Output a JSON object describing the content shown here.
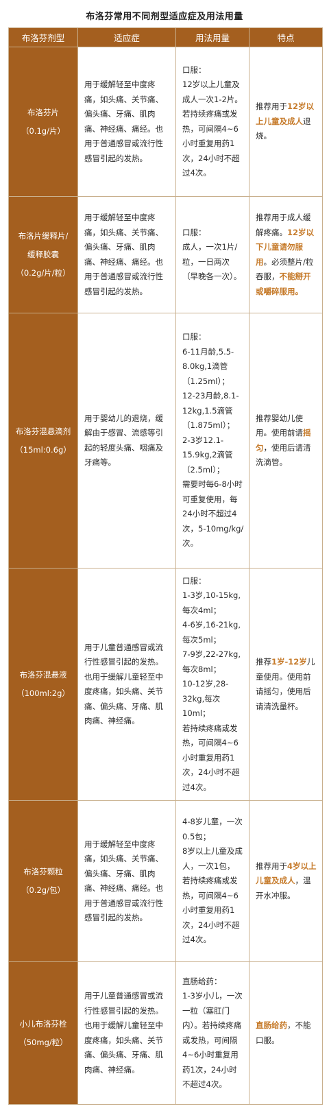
{
  "title": "布洛芬常用不同剂型适应症及用法用量",
  "headers": [
    "布洛芬剂型",
    "适应症",
    "用法用量",
    "特点"
  ],
  "colors": {
    "header_bg": "#a45f1f",
    "highlight": "#c67b2b",
    "border": "#c9b08e"
  },
  "rows": [
    {
      "type": "布洛芬片（0.1g/片）",
      "indication": "用于缓解轻至中度疼痛，如头痛、关节痛、偏头痛、牙痛、肌肉痛、神经痛、痛经。也用于普通感冒或流行性感冒引起的发热。",
      "dosage": [
        "口服：",
        "12岁以上儿童及成人一次1-2片。",
        "若持续疼痛或发热，可间隔4~6小时重复用药1次，24小时不超过4次。"
      ],
      "feature": [
        [
          "推荐用于",
          false
        ],
        [
          "12岁以上儿童及成人",
          true
        ],
        [
          "退烧。",
          false
        ]
      ]
    },
    {
      "type": "布洛片缓释片/缓释胶囊（0.2g/片/粒）",
      "indication": "用于缓解轻至中度疼痛，如头痛、关节痛、偏头痛、牙痛、肌肉痛、神经痛、痛经。也用于普通感冒或流行性感冒引起的发热。",
      "dosage": [
        "口服：",
        "成人，一次1片/粒，一日两次（早晚各一次）。"
      ],
      "feature": [
        [
          "推荐用于成人缓解疼痛。",
          false
        ],
        [
          "12岁以下儿童请勿服用",
          true
        ],
        [
          "。必须整片/粒吞服，",
          false
        ],
        [
          "不能掰开或嚼碎服用。",
          true
        ]
      ]
    },
    {
      "type": "布洛芬混悬滴剂（15ml:0.6g）",
      "indication": "用于婴幼儿的退烧，缓解由于感冒、流感等引起的轻度头痛、咽痛及牙痛等。",
      "dosage": [
        "口服：",
        "6-11月龄,5.5-8.0kg,1滴管（1.25ml）；",
        "12-23月龄,8.1-12kg,1.5滴管（1.875ml）；",
        "2-3岁12.1-15.9kg,2滴管（2.5ml）；",
        "需要时每6-8小时可重复使用，每24小时不超过4次，5-10mg/kg/次。"
      ],
      "feature": [
        [
          "推荐婴幼儿使用。使用前请",
          false
        ],
        [
          "摇匀",
          true
        ],
        [
          "，使用后请清洗滴管。",
          false
        ]
      ]
    },
    {
      "type": "布洛芬混悬液（100ml:2g）",
      "indication": "用于儿童普通感冒或流行性感冒引起的发热。也用于缓解儿童轻至中度疼痛，如头痛、关节痛、偏头痛、牙痛、肌肉痛、神经痛。",
      "dosage": [
        "口服：",
        "1-3岁,10-15kg,每次4ml；",
        "4-6岁,16-21kg,每次5ml；",
        "7-9岁,22-27kg,每次8ml；",
        "10-12岁,28-32kg,每次10ml；",
        "若持续疼痛或发热，可间隔4~6小时重复用药1次，24小时不超过4次。"
      ],
      "feature": [
        [
          "推荐",
          false
        ],
        [
          "1岁-12岁",
          true
        ],
        [
          "儿童使用。使用前请摇匀，使用后请清洗量杯。",
          false
        ]
      ]
    },
    {
      "type": "布洛芬颗粒（0.2g/包）",
      "indication": "用于缓解轻至中度疼痛，如头痛、关节痛、偏头痛、牙痛、肌肉痛、神经痛、痛经。也用于普通感冒或流行性感冒引起的发热。",
      "dosage": [
        "4-8岁儿童，一次0.5包；",
        "8岁以上儿童及成人，一次1包，",
        "若持续疼痛或发热，可间隔4~6小时重复用药1次，24小时不超过4次。"
      ],
      "feature": [
        [
          "推荐用于",
          false
        ],
        [
          "4岁以上儿童及成人",
          true
        ],
        [
          "，温开水冲服。",
          false
        ]
      ]
    },
    {
      "type": "小儿布洛芬栓（50mg/粒）",
      "indication": "用于儿童普通感冒或流行性感冒引起的发热。也用于缓解儿童轻至中度疼痛，如头痛、关节痛、偏头痛、牙痛、肌肉痛、神经痛。",
      "dosage": [
        "直肠给药：",
        "1-3岁小儿，一次一粒（塞肛门内）。若持续疼痛或发热，可间隔4~6小时重复用药1次，24小时不超过4次。"
      ],
      "feature": [
        [
          "直肠给药",
          true
        ],
        [
          "，不能口服。",
          false
        ]
      ]
    }
  ]
}
